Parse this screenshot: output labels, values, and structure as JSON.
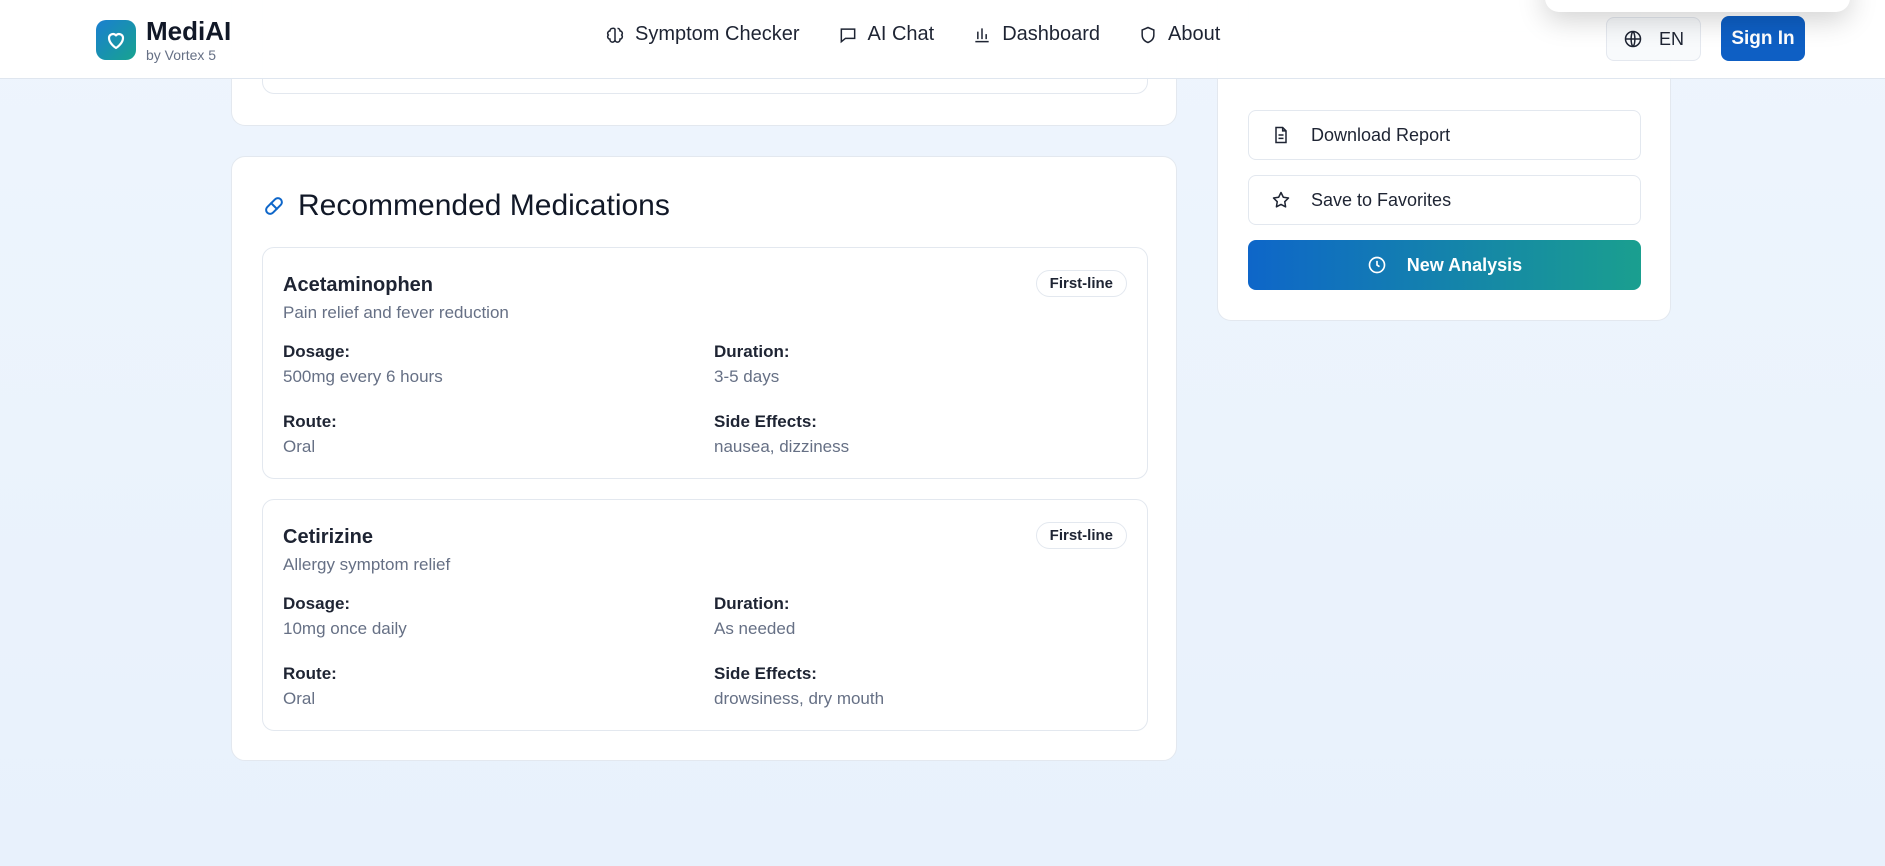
{
  "brand": {
    "name": "MediAI",
    "subtitle": "by Vortex 5"
  },
  "nav": {
    "items": [
      {
        "label": "Symptom Checker",
        "icon": "brain-icon"
      },
      {
        "label": "AI Chat",
        "icon": "message-icon"
      },
      {
        "label": "Dashboard",
        "icon": "bar-chart-icon"
      },
      {
        "label": "About",
        "icon": "shield-icon"
      }
    ],
    "language": "EN",
    "signin": "Sign In"
  },
  "medications": {
    "title": "Recommended Medications",
    "items": [
      {
        "name": "Acetaminophen",
        "description": "Pain relief and fever reduction",
        "badge": "First-line",
        "dosage_label": "Dosage:",
        "dosage": "500mg every 6 hours",
        "duration_label": "Duration:",
        "duration": "3-5 days",
        "route_label": "Route:",
        "route": "Oral",
        "side_effects_label": "Side Effects:",
        "side_effects": "nausea, dizziness"
      },
      {
        "name": "Cetirizine",
        "description": "Allergy symptom relief",
        "badge": "First-line",
        "dosage_label": "Dosage:",
        "dosage": "10mg once daily",
        "duration_label": "Duration:",
        "duration": "As needed",
        "route_label": "Route:",
        "route": "Oral",
        "side_effects_label": "Side Effects:",
        "side_effects": "drowsiness, dry mouth"
      }
    ]
  },
  "actions": {
    "download": "Download Report",
    "favorite": "Save to Favorites",
    "new_analysis": "New Analysis"
  },
  "colors": {
    "primary": "#0e5fc4",
    "accent_gradient_start": "#0e66c9",
    "accent_gradient_end": "#1a9f8f",
    "background": "#eef5fd"
  }
}
